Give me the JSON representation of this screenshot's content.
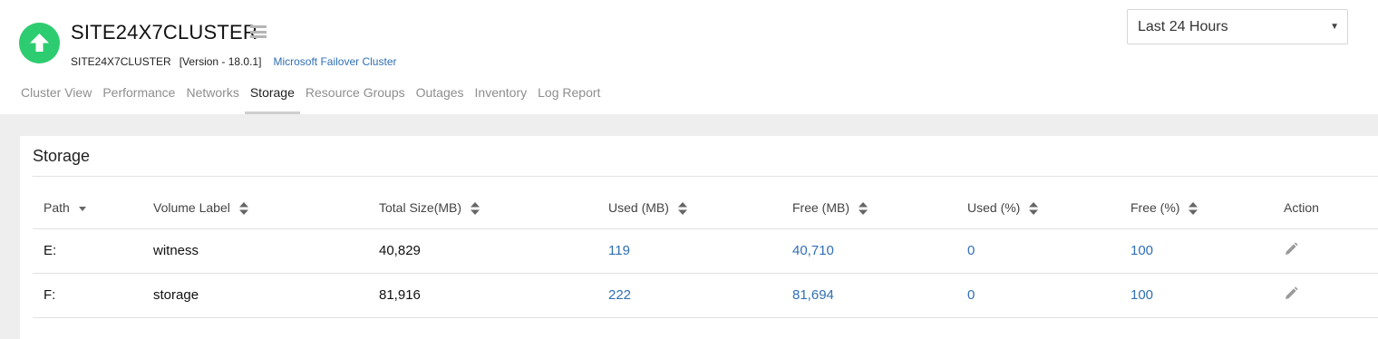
{
  "header": {
    "monitor_name": "SITE24X7CLUSTER",
    "sub_name": "SITE24X7CLUSTER",
    "version": "[Version - 18.0.1]",
    "monitor_type": "Microsoft Failover Cluster",
    "status": "up",
    "status_color": "#2ecc71",
    "period": "Last 24 Hours"
  },
  "tabs": [
    {
      "label": "Cluster View",
      "active": false
    },
    {
      "label": "Performance",
      "active": false
    },
    {
      "label": "Networks",
      "active": false
    },
    {
      "label": "Storage",
      "active": true
    },
    {
      "label": "Resource Groups",
      "active": false
    },
    {
      "label": "Outages",
      "active": false
    },
    {
      "label": "Inventory",
      "active": false
    },
    {
      "label": "Log Report",
      "active": false
    }
  ],
  "storage": {
    "title": "Storage",
    "columns": [
      "Path",
      "Volume Label",
      "Total Size(MB)",
      "Used (MB)",
      "Free (MB)",
      "Used (%)",
      "Free (%)",
      "Action"
    ],
    "rows": [
      {
        "path": "E:",
        "label": "witness",
        "total": "40,829",
        "used": "119",
        "free": "40,710",
        "used_pct": "0",
        "free_pct": "100"
      },
      {
        "path": "F:",
        "label": "storage",
        "total": "81,916",
        "used": "222",
        "free": "81,694",
        "used_pct": "0",
        "free_pct": "100"
      }
    ]
  },
  "colors": {
    "link": "#2f6fb5",
    "accent_up": "#2ecc71",
    "background": "#eeeeee"
  }
}
